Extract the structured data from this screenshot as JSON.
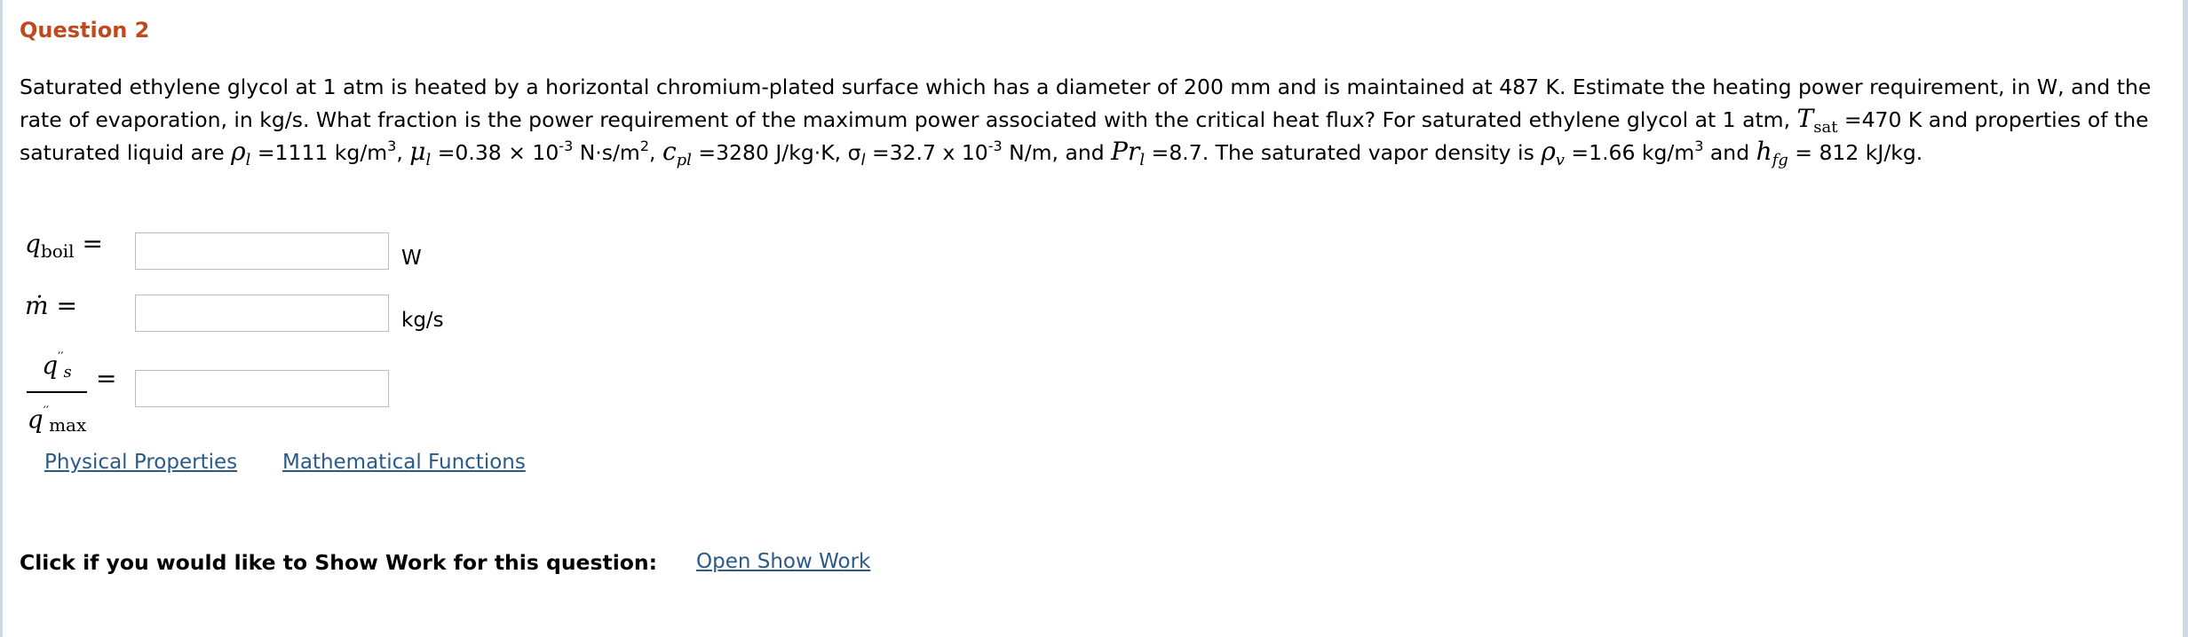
{
  "question": {
    "title": "Question 2",
    "text": {
      "p1": "Saturated ethylene glycol at 1 atm is heated by a horizontal chromium-plated surface which has a diameter of 200 mm and is maintained at 487 K. Estimate the heating power requirement, in W, and the rate of evaporation, in kg/s. What fraction is the power requirement of the maximum power associated with the critical heat flux? For saturated ethylene glycol at 1 atm, ",
      "tsat_sym": "T",
      "tsat_sub": "sat",
      "p2": " =470 K and properties of the saturated liquid are ",
      "rho_sym": "ρ",
      "l_sub": "l",
      "p3": " =1111 kg/m",
      "sup3": "3",
      "p4": ", ",
      "mu_sym": "μ",
      "p5": " =0.38 × 10",
      "supm3": "-3",
      "p6": " N·s/m",
      "sup2": "2",
      "p7": ", ",
      "cp_sym": "c",
      "pl_sub": "pl",
      "p8": " =3280 J/kg·K, σ",
      "p9": " =32.7 x 10",
      "p10": " N/m, and ",
      "pr_sym": "Pr",
      "p11": " =8.7. The saturated vapor density is ",
      "v_sub": "v",
      "p12": " =1.66 kg/m",
      "p13": " and ",
      "h_sym": "h",
      "fg_sub": "fg",
      "p14": " = 812 kJ/kg."
    }
  },
  "answers": {
    "q_boil": {
      "symbol": "q",
      "sub": "boil",
      "eq": " =",
      "value": "",
      "placeholder": "",
      "unit": "W"
    },
    "m_dot": {
      "symbol": "ṁ",
      "eq": " =",
      "value": "",
      "placeholder": "",
      "unit": "kg/s"
    },
    "ratio": {
      "num": "q",
      "num_sub": "s",
      "den": "q",
      "den_sub": "max",
      "prime": "′′",
      "eq": "=",
      "value": "",
      "placeholder": ""
    }
  },
  "links": {
    "physical_properties": "Physical Properties",
    "mathematical_functions": "Mathematical Functions"
  },
  "show_work": {
    "prompt": "Click if you would like to Show Work for this question:",
    "link": "Open Show Work"
  },
  "colors": {
    "title": "#c0491d",
    "link": "#2b5a88",
    "input_border": "#bdbdbd",
    "frame": "#cfd9e3"
  }
}
